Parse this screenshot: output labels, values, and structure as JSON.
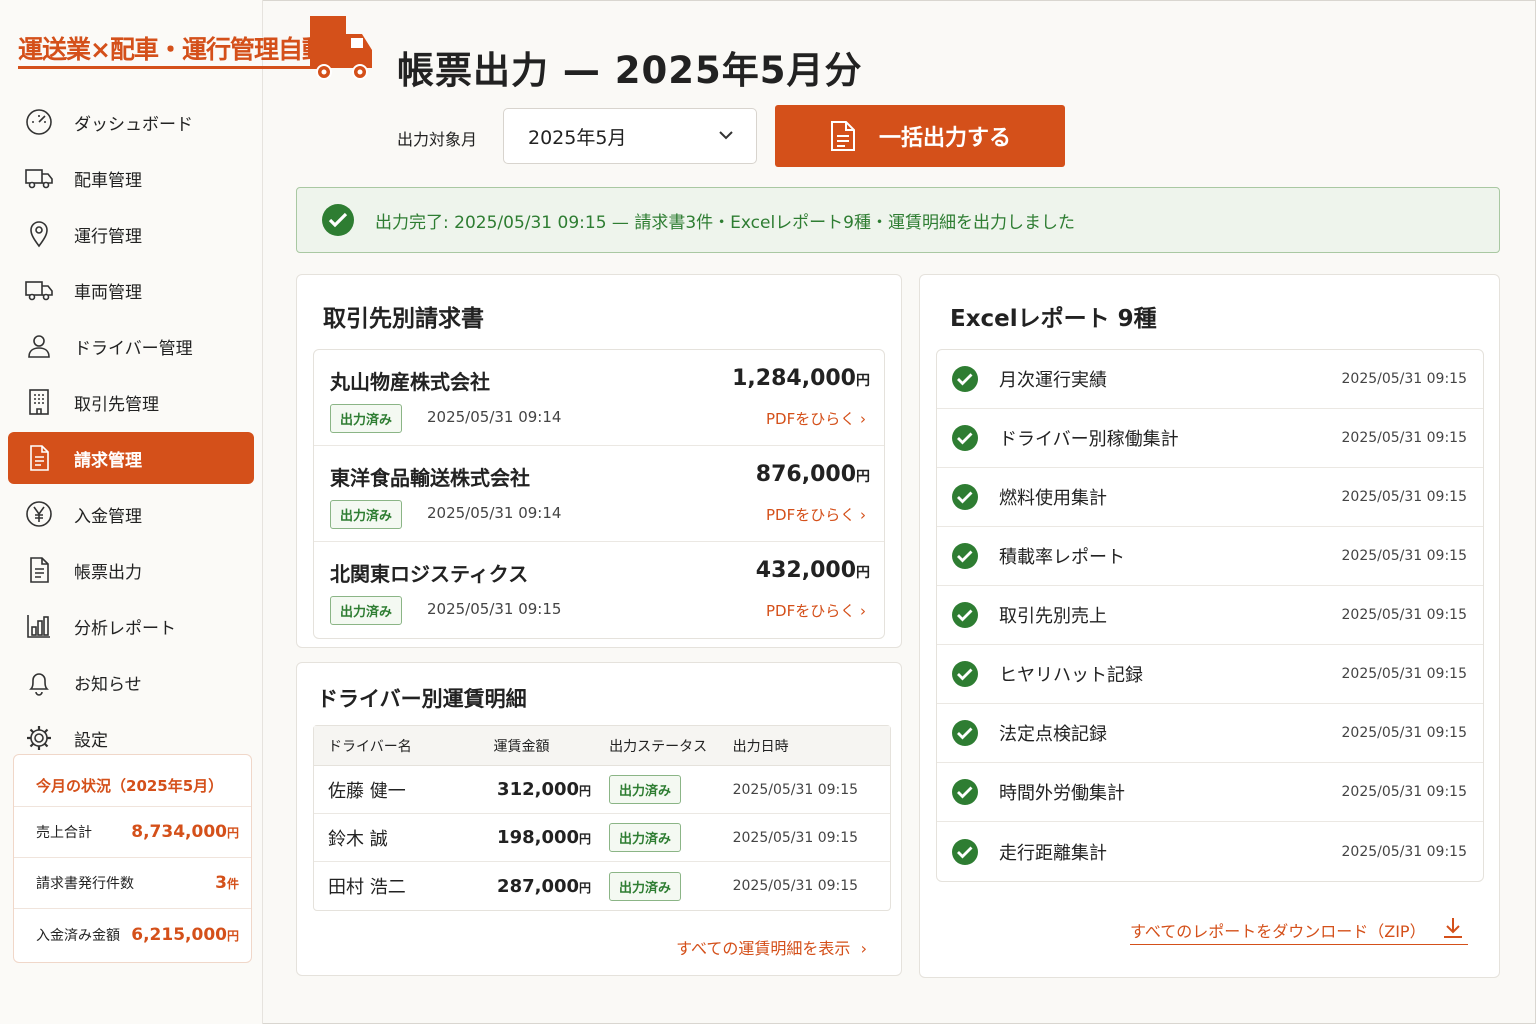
{
  "app": {
    "logo": "運送業×配車・運行管理自動化"
  },
  "sidebar": {
    "items": [
      {
        "label": "ダッシュボード",
        "icon": "gauge-icon"
      },
      {
        "label": "配車管理",
        "icon": "truck-icon"
      },
      {
        "label": "運行管理",
        "icon": "map-pin-icon"
      },
      {
        "label": "車両管理",
        "icon": "truck-icon"
      },
      {
        "label": "ドライバー管理",
        "icon": "person-icon"
      },
      {
        "label": "取引先管理",
        "icon": "building-icon"
      },
      {
        "label": "請求管理",
        "icon": "document-icon",
        "active": true
      },
      {
        "label": "入金管理",
        "icon": "yen-icon"
      },
      {
        "label": "帳票出力",
        "icon": "document-icon"
      },
      {
        "label": "分析レポート",
        "icon": "bar-chart-icon"
      },
      {
        "label": "お知らせ",
        "icon": "bell-icon"
      },
      {
        "label": "設定",
        "icon": "gear-icon"
      }
    ],
    "summary": {
      "title": "今月の状況（2025年5月）",
      "rows": [
        {
          "key": "売上合計",
          "value": "8,734,000",
          "unit": "円"
        },
        {
          "key": "請求書発行件数",
          "value": "3",
          "unit": "件"
        },
        {
          "key": "入金済み金額",
          "value": "6,215,000",
          "unit": "円"
        }
      ]
    }
  },
  "header": {
    "title": "帳票出力 — 2025年5月分",
    "month_label": "出力対象月",
    "month_value": "2025年5月",
    "bulk_button": "一括出力する"
  },
  "alert": {
    "text": "出力完了: 2025/05/31 09:15 — 請求書3件・Excelレポート9種・運賃明細を出力しました"
  },
  "invoices": {
    "title": "取引先別請求書",
    "items": [
      {
        "name": "丸山物産株式会社",
        "amount": "1,284,000",
        "unit": "円",
        "status": "出力済み",
        "date": "2025/05/31 09:14",
        "link": "PDFをひらく"
      },
      {
        "name": "東洋食品輸送株式会社",
        "amount": "876,000",
        "unit": "円",
        "status": "出力済み",
        "date": "2025/05/31 09:14",
        "link": "PDFをひらく"
      },
      {
        "name": "北関東ロジスティクス",
        "amount": "432,000",
        "unit": "円",
        "status": "出力済み",
        "date": "2025/05/31 09:15",
        "link": "PDFをひらく"
      }
    ]
  },
  "drivers": {
    "title": "ドライバー別運賃明細",
    "columns": [
      "ドライバー名",
      "運賃金額",
      "出力ステータス",
      "出力日時"
    ],
    "rows": [
      {
        "name": "佐藤 健一",
        "amount": "312,000",
        "unit": "円",
        "status": "出力済み",
        "date": "2025/05/31 09:15"
      },
      {
        "name": "鈴木 誠",
        "amount": "198,000",
        "unit": "円",
        "status": "出力済み",
        "date": "2025/05/31 09:15"
      },
      {
        "name": "田村 浩二",
        "amount": "287,000",
        "unit": "円",
        "status": "出力済み",
        "date": "2025/05/31 09:15"
      }
    ],
    "more_link": "すべての運賃明細を表示"
  },
  "excel": {
    "title": "Excelレポート 9種",
    "items": [
      {
        "name": "月次運行実績",
        "date": "2025/05/31 09:15"
      },
      {
        "name": "ドライバー別稼働集計",
        "date": "2025/05/31 09:15"
      },
      {
        "name": "燃料使用集計",
        "date": "2025/05/31 09:15"
      },
      {
        "name": "積載率レポート",
        "date": "2025/05/31 09:15"
      },
      {
        "name": "取引先別売上",
        "date": "2025/05/31 09:15"
      },
      {
        "name": "ヒヤリハット記録",
        "date": "2025/05/31 09:15"
      },
      {
        "name": "法定点検記録",
        "date": "2025/05/31 09:15"
      },
      {
        "name": "時間外労働集計",
        "date": "2025/05/31 09:15"
      },
      {
        "name": "走行距離集計",
        "date": "2025/05/31 09:15"
      }
    ],
    "zip_link": "すべてのレポートをダウンロード（ZIP）"
  },
  "colors": {
    "accent": "#d4501a",
    "success": "#2e7d32",
    "success_bg": "#eef4ec"
  }
}
